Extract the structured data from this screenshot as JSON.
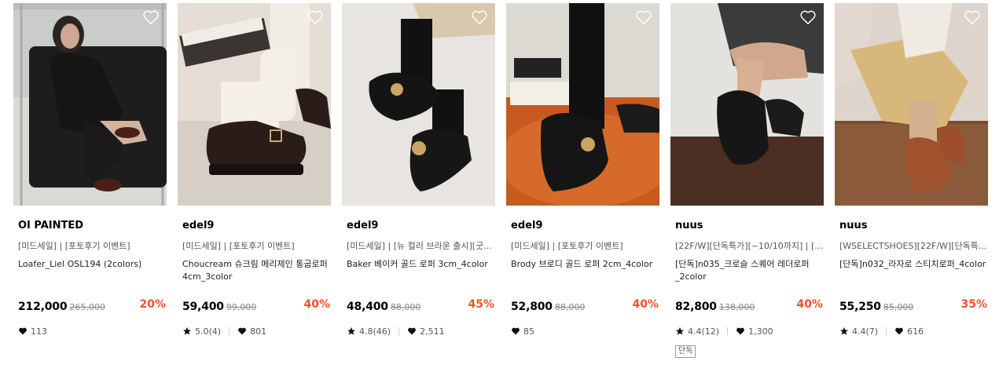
{
  "products": [
    {
      "brand": "OI PAINTED",
      "tags": "[미드세일] | [포토후기 이벤트]",
      "name": "Loafer_Liel OSL194 (2colors)",
      "price": "212,000",
      "original_price": "265,000",
      "discount": "20%",
      "rating": "",
      "likes": "113",
      "badge": ""
    },
    {
      "brand": "edel9",
      "tags": "[미드세일] | [포토후기 이벤트]",
      "name": "Choucream 슈크림 메리제인 통굽로퍼 4cm_3color",
      "price": "59,400",
      "original_price": "99,000",
      "discount": "40%",
      "rating": "5.0(4)",
      "likes": "801",
      "badge": ""
    },
    {
      "brand": "edel9",
      "tags": "[미드세일] | [뉴 컬러 브라운 출시][굿...",
      "name": "Baker 베이커 골드 로퍼 3cm_4color",
      "price": "48,400",
      "original_price": "88,000",
      "discount": "45%",
      "rating": "4.8(46)",
      "likes": "2,511",
      "badge": ""
    },
    {
      "brand": "edel9",
      "tags": "[미드세일] | [포토후기 이벤트]",
      "name": "Brody 브로디 골드 로퍼 2cm_4color",
      "price": "52,800",
      "original_price": "88,000",
      "discount": "40%",
      "rating": "",
      "likes": "85",
      "badge": ""
    },
    {
      "brand": "nuus",
      "tags": "[22F/W][단독특가][~10/10까지] | [미...",
      "name": "[단독]n035_크로슬 스퀘어 레더로퍼_2color",
      "price": "82,800",
      "original_price": "138,000",
      "discount": "40%",
      "rating": "4.4(12)",
      "likes": "1,300",
      "badge": "단독"
    },
    {
      "brand": "nuus",
      "tags": "[WSELECTSHOES][22F/W][단독특...",
      "name": "[단독]n032_라자로 스티치로퍼_4color",
      "price": "55,250",
      "original_price": "85,000",
      "discount": "35%",
      "rating": "4.4(7)",
      "likes": "616",
      "badge": ""
    }
  ],
  "colors": {
    "discount": "#f54f2a",
    "text_muted": "#555555",
    "strike": "#888888"
  },
  "icons": {
    "wishlist": "heart-outline-icon",
    "likes": "heart-filled-icon",
    "rating": "star-icon"
  }
}
